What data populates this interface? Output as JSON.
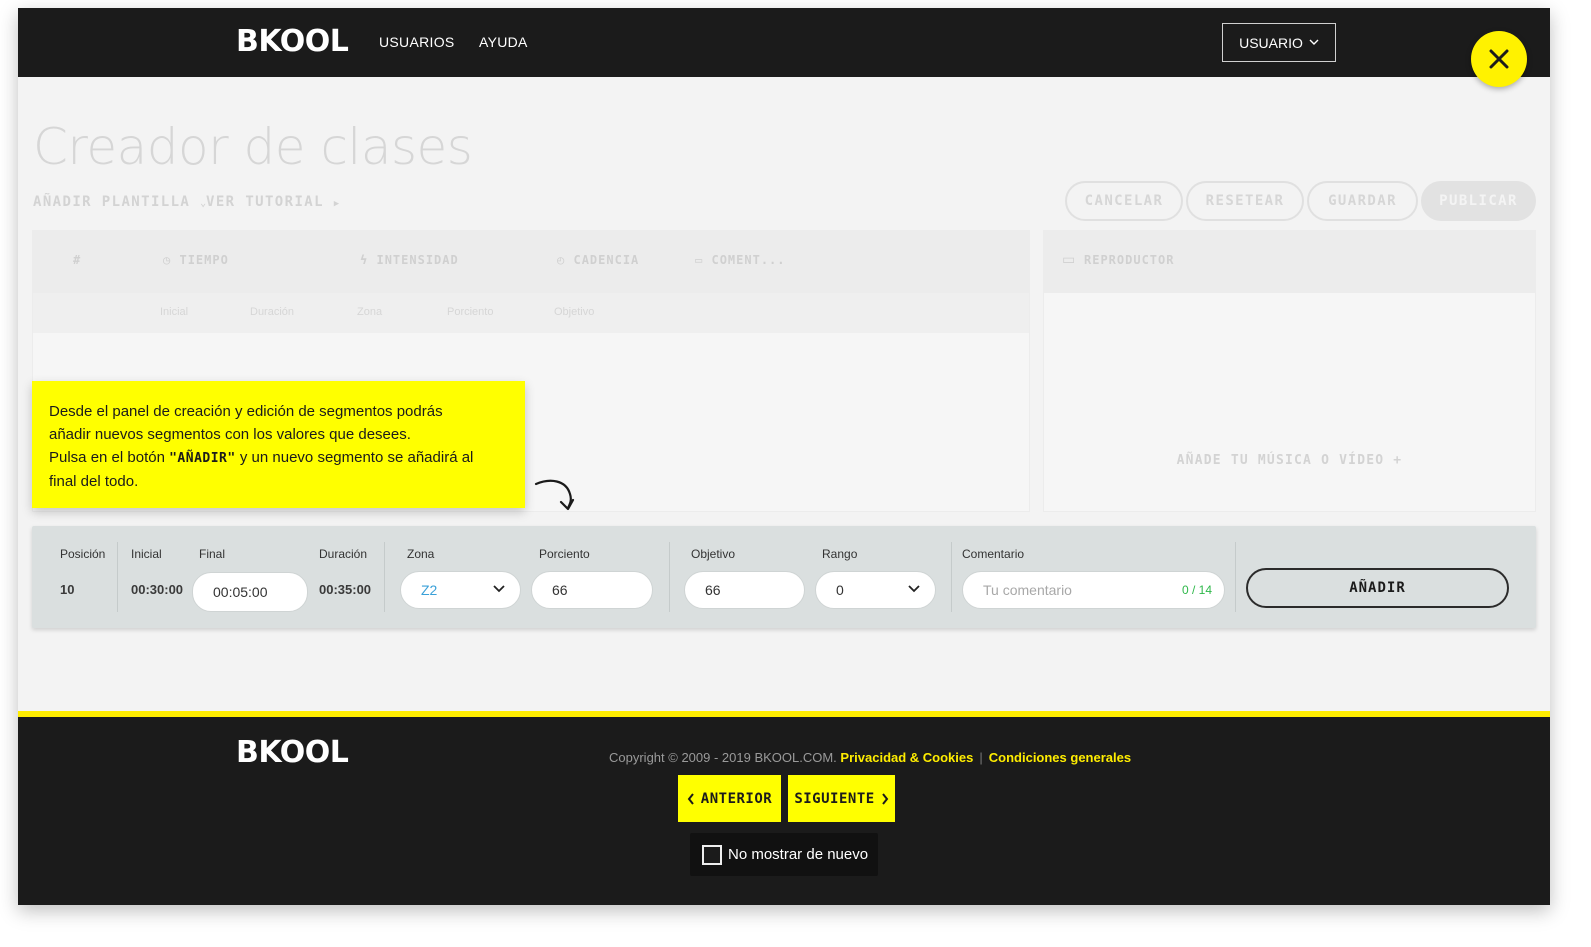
{
  "header": {
    "logo": "BKOOL",
    "nav": [
      "USUARIOS",
      "AYUDA"
    ],
    "user_menu": "USUARIO"
  },
  "page": {
    "title": "Creador de clases",
    "links": {
      "template": "AÑADIR PLANTILLA",
      "tutorial": "VER TUTORIAL"
    },
    "actions": {
      "cancel": "CANCELAR",
      "reset": "RESETEAR",
      "save": "GUARDAR",
      "publish": "PUBLICAR"
    },
    "table": {
      "columns": [
        "#",
        "TIEMPO",
        "INTENSIDAD",
        "CADENCIA",
        "COMENT..."
      ],
      "subcolumns": [
        "Inicial",
        "Duración",
        "Zona",
        "Porciento",
        "Objetivo"
      ]
    },
    "player": {
      "title": "REPRODUCTOR",
      "add_media": "AÑADE TU MÚSICA O VÍDEO +"
    }
  },
  "tooltip": {
    "line1": "Desde el panel de creación y edición de segmentos podrás",
    "line2": "añadir nuevos segmentos con los valores que desees.",
    "line3_pre": "Pulsa en el botón ",
    "line3_kw": "\"AÑADIR\"",
    "line3_post": " y un nuevo segmento se añadirá al",
    "line4": "final del todo."
  },
  "editor": {
    "labels": {
      "position": "Posición",
      "start": "Inicial",
      "end": "Final",
      "duration": "Duración",
      "zone": "Zona",
      "percent": "Porciento",
      "target": "Objetivo",
      "range": "Rango",
      "comment": "Comentario"
    },
    "values": {
      "position": "10",
      "start": "00:30:00",
      "end": "00:05:00",
      "duration": "00:35:00",
      "zone": "Z2",
      "percent": "66",
      "target": "66",
      "range": "0"
    },
    "comment_placeholder": "Tu comentario",
    "comment_counter": "0 / 14",
    "add_button": "AÑADIR"
  },
  "footer": {
    "logo": "BKOOL",
    "copyright": "Copyright © 2009 - 2019 BKOOL.COM.",
    "privacy": "Privacidad & Cookies",
    "separator": "|",
    "terms": "Condiciones generales",
    "prev": "ANTERIOR",
    "next": "SIGUIENTE",
    "dont_show": "No mostrar de nuevo"
  },
  "colors": {
    "accent": "#ffff00",
    "dark": "#1b1b1b",
    "zone_text": "#3aa0d8",
    "counter": "#2eb84a"
  }
}
